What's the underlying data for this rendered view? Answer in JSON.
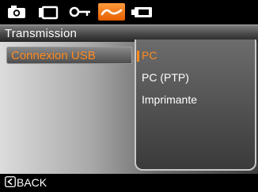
{
  "tabs": [
    {
      "icon": "camera-icon",
      "active": false
    },
    {
      "icon": "playback-icon",
      "active": false
    },
    {
      "icon": "key-icon",
      "active": false
    },
    {
      "icon": "settings-wave-icon",
      "active": true
    },
    {
      "icon": "battery-icon",
      "active": false
    }
  ],
  "header": {
    "title": "Transmission"
  },
  "menu": {
    "selected_item": "Connexion USB"
  },
  "options": [
    "PC",
    "PC (PTP)",
    "Imprimante"
  ],
  "selected_option_index": 0,
  "footer": {
    "back_icon": "back-arrow-icon",
    "back_label": "BACK"
  },
  "colors": {
    "accent": "#ff8a1e",
    "active_tab": "#f07a10"
  }
}
